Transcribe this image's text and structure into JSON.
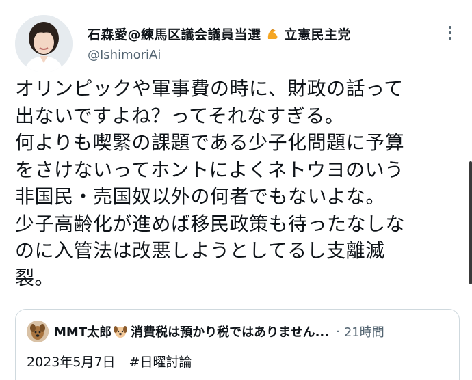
{
  "author": {
    "display_name": "石森愛@練馬区議会議員当選",
    "party": "立憲民主党",
    "handle": "@IshimoriAi",
    "badge_icon": "flexed-arm-emoji"
  },
  "tweet": {
    "lines": [
      "オリンピックや軍事費の時に、財政の話って",
      "出ないですよね？ってそれなすぎる。",
      "何よりも喫緊の課題である少子化問題に予算",
      "をさけないってホントによくネトウヨのいう",
      "非国民・売国奴以外の何者でもないよな。",
      "少子高齢化が進めば移民政策も待ったなしな",
      "のに入管法は改悪しようとしてるし支離滅",
      "裂。"
    ]
  },
  "quoted": {
    "name": "MMT太郎",
    "name_icon": "dog-emoji",
    "title": "消費税は預かり税ではありません...",
    "separator": "·",
    "time": "21時間",
    "date": "2023年5月7日",
    "hashtag": "#日曜討論"
  },
  "colors": {
    "text": "#0f1419",
    "secondary": "#536471",
    "border": "#cfd9de"
  }
}
